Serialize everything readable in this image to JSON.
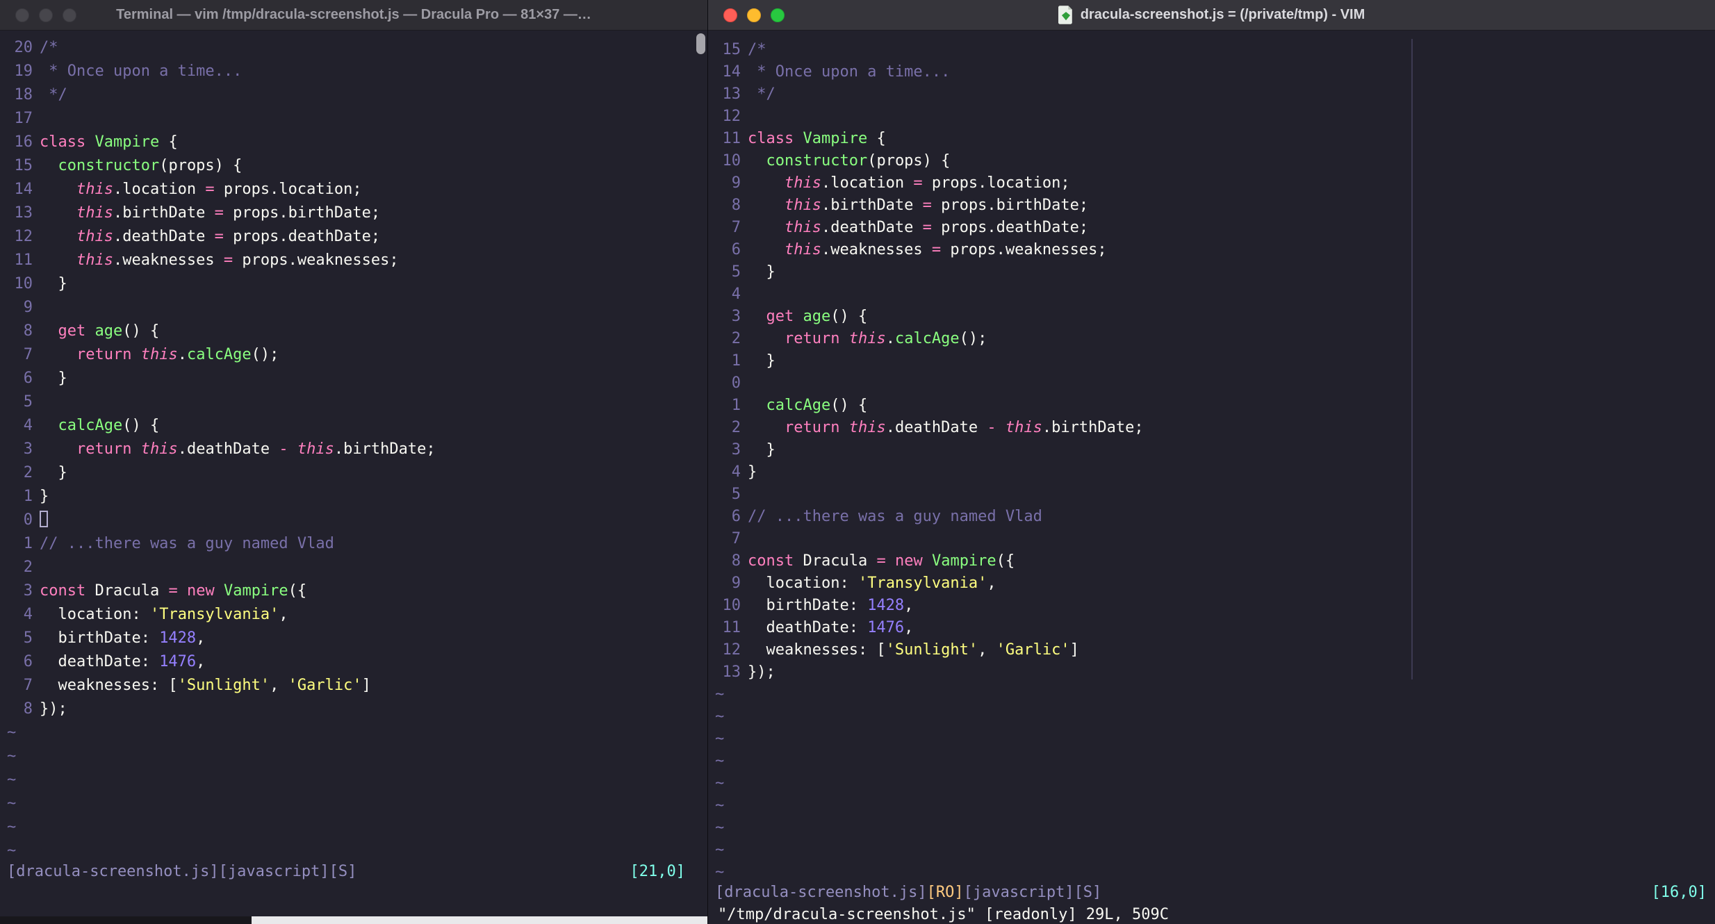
{
  "colors": {
    "bg": "#22212C",
    "fg": "#F8F8F2",
    "comment": "#7970A9",
    "pink": "#FF80BF",
    "green": "#8AFF80",
    "yellow": "#FFFF80",
    "purple": "#9580FF",
    "cyan": "#80FFEA",
    "orange": "#FFCA80",
    "status": "#958FC0"
  },
  "tilde": "~",
  "code_lines": [
    [
      [
        "/*",
        "comment"
      ]
    ],
    [
      [
        " * Once upon a time...",
        "comment"
      ]
    ],
    [
      [
        " */",
        "comment"
      ]
    ],
    [],
    [
      [
        "class",
        "pink"
      ],
      [
        " ",
        "fg"
      ],
      [
        "Vampire",
        "green"
      ],
      [
        " {",
        "fg"
      ]
    ],
    [
      [
        "  ",
        "fg"
      ],
      [
        "constructor",
        "green"
      ],
      [
        "(props) {",
        "fg"
      ]
    ],
    [
      [
        "    ",
        "fg"
      ],
      [
        "this",
        "pink_i"
      ],
      [
        ".location ",
        "fg"
      ],
      [
        "=",
        "pink"
      ],
      [
        " props.location;",
        "fg"
      ]
    ],
    [
      [
        "    ",
        "fg"
      ],
      [
        "this",
        "pink_i"
      ],
      [
        ".birthDate ",
        "fg"
      ],
      [
        "=",
        "pink"
      ],
      [
        " props.birthDate;",
        "fg"
      ]
    ],
    [
      [
        "    ",
        "fg"
      ],
      [
        "this",
        "pink_i"
      ],
      [
        ".deathDate ",
        "fg"
      ],
      [
        "=",
        "pink"
      ],
      [
        " props.deathDate;",
        "fg"
      ]
    ],
    [
      [
        "    ",
        "fg"
      ],
      [
        "this",
        "pink_i"
      ],
      [
        ".weaknesses ",
        "fg"
      ],
      [
        "=",
        "pink"
      ],
      [
        " props.weaknesses;",
        "fg"
      ]
    ],
    [
      [
        "  }",
        "fg"
      ]
    ],
    [],
    [
      [
        "  ",
        "fg"
      ],
      [
        "get",
        "pink"
      ],
      [
        " ",
        "fg"
      ],
      [
        "age",
        "green"
      ],
      [
        "() {",
        "fg"
      ]
    ],
    [
      [
        "    ",
        "fg"
      ],
      [
        "return",
        "pink"
      ],
      [
        " ",
        "fg"
      ],
      [
        "this",
        "pink_i"
      ],
      [
        ".",
        "fg"
      ],
      [
        "calcAge",
        "green"
      ],
      [
        "();",
        "fg"
      ]
    ],
    [
      [
        "  }",
        "fg"
      ]
    ],
    [],
    [
      [
        "  ",
        "fg"
      ],
      [
        "calcAge",
        "green"
      ],
      [
        "() {",
        "fg"
      ]
    ],
    [
      [
        "    ",
        "fg"
      ],
      [
        "return",
        "pink"
      ],
      [
        " ",
        "fg"
      ],
      [
        "this",
        "pink_i"
      ],
      [
        ".deathDate ",
        "fg"
      ],
      [
        "-",
        "pink"
      ],
      [
        " ",
        "fg"
      ],
      [
        "this",
        "pink_i"
      ],
      [
        ".birthDate;",
        "fg"
      ]
    ],
    [
      [
        "  }",
        "fg"
      ]
    ],
    [
      [
        "}",
        "fg"
      ]
    ],
    [],
    [
      [
        "// ...there was a guy named Vlad",
        "comment"
      ]
    ],
    [],
    [
      [
        "const",
        "pink"
      ],
      [
        " Dracula ",
        "fg"
      ],
      [
        "=",
        "pink"
      ],
      [
        " ",
        "fg"
      ],
      [
        "new",
        "pink"
      ],
      [
        " ",
        "fg"
      ],
      [
        "Vampire",
        "green"
      ],
      [
        "({",
        "fg"
      ]
    ],
    [
      [
        "  location: ",
        "fg"
      ],
      [
        "'Transylvania'",
        "yellow"
      ],
      [
        ",",
        "fg"
      ]
    ],
    [
      [
        "  birthDate: ",
        "fg"
      ],
      [
        "1428",
        "purple"
      ],
      [
        ",",
        "fg"
      ]
    ],
    [
      [
        "  deathDate: ",
        "fg"
      ],
      [
        "1476",
        "purple"
      ],
      [
        ",",
        "fg"
      ]
    ],
    [
      [
        "  weaknesses: [",
        "fg"
      ],
      [
        "'Sunlight'",
        "yellow"
      ],
      [
        ", ",
        "fg"
      ],
      [
        "'Garlic'",
        "yellow"
      ],
      [
        "]",
        "fg"
      ]
    ],
    [
      [
        "});",
        "fg"
      ]
    ]
  ],
  "left": {
    "title": "Terminal — vim /tmp/dracula-screenshot.js — Dracula Pro — 81×37 —…",
    "rel_numbers": [
      "20",
      "19",
      "18",
      "17",
      "16",
      "15",
      "14",
      "13",
      "12",
      "11",
      "10",
      "9",
      "8",
      "7",
      "6",
      "5",
      "4",
      "3",
      "2",
      "1",
      "0",
      "1",
      "2",
      "3",
      "4",
      "5",
      "6",
      "7",
      "8"
    ],
    "cursor_line_index": 20,
    "cursor_style": "hollow",
    "tilde_count": 6,
    "status_segments": [
      [
        "[dracula-screenshot.js][javascript][S]",
        "status"
      ]
    ],
    "ruler": "[21,0]",
    "command_line": ""
  },
  "right": {
    "title": "dracula-screenshot.js = (/private/tmp) - VIM",
    "rel_numbers": [
      "15",
      "14",
      "13",
      "12",
      "11",
      "10",
      "9",
      "8",
      "7",
      "6",
      "5",
      "4",
      "3",
      "2",
      "1",
      "0",
      "1",
      "2",
      "3",
      "4",
      "5",
      "6",
      "7",
      "8",
      "9",
      "10",
      "11",
      "12",
      "13"
    ],
    "cursor_line_index": 15,
    "cursor_style": "none",
    "tilde_count": 9,
    "status_segments": [
      [
        "[dracula-screenshot.js]",
        "status"
      ],
      [
        "[RO]",
        "orange"
      ],
      [
        "[javascript][S]",
        "status"
      ]
    ],
    "ruler": "[16,0]",
    "command_line": "\"/tmp/dracula-screenshot.js\" [readonly] 29L, 509C"
  }
}
